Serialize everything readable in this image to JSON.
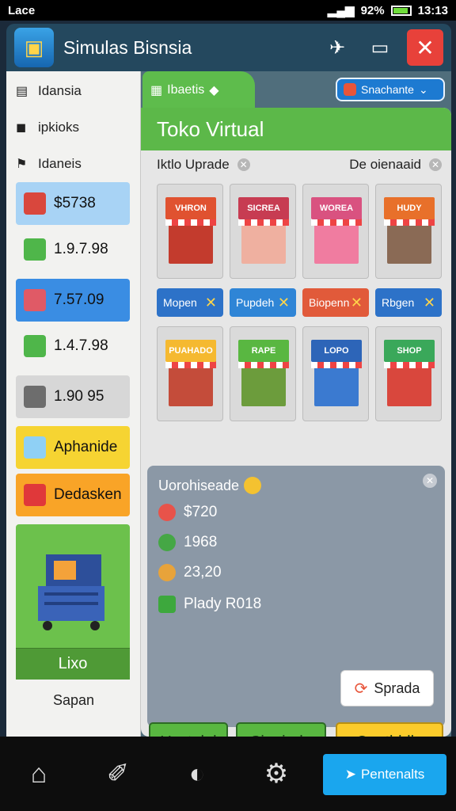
{
  "status_bar": {
    "carrier": "Lace",
    "battery": "92%",
    "time": "13:13"
  },
  "app": {
    "title": "Simulas Bisnsia",
    "logo_icon": "shop-icon"
  },
  "sidebar": {
    "links": [
      "Idansia",
      "ipkioks",
      "Idaneis"
    ],
    "stats": [
      {
        "value": "$5738",
        "color": "#a8d3f5",
        "icon_color": "#d9473d"
      },
      {
        "value": "1.9.7.98",
        "color": "#f2f2f0",
        "icon_color": "#4fb64a"
      },
      {
        "value": "7.57.09",
        "color": "#3a8de3",
        "icon_color": "#e05a66"
      },
      {
        "value": "1.4.7.98",
        "color": "#f2f2f0",
        "icon_color": "#4fb64a"
      },
      {
        "value": "1.90 95",
        "color": "#d7d7d7",
        "icon_color": "#6d6d6d"
      }
    ],
    "actions": [
      {
        "label": "Aphanide",
        "color": "#f6d432"
      },
      {
        "label": "Dedasken",
        "color": "#f9a427"
      }
    ],
    "card_label": "Lixo",
    "footer": "Sapan"
  },
  "tabs": {
    "active": "Ibaetis",
    "right_label": "Snachante"
  },
  "panel": {
    "title": "Toko Virtual",
    "filters": [
      "Iktlo Uprade",
      "De oienaaid"
    ],
    "shops": [
      {
        "sign": "VHRON",
        "sign_color": "#e05230",
        "body": "#c33b2d"
      },
      {
        "sign": "SICREA",
        "sign_color": "#c73c52",
        "body": "#efb0a0"
      },
      {
        "sign": "WOREA",
        "sign_color": "#d95280",
        "body": "#f07ca0"
      },
      {
        "sign": "HUDY",
        "sign_color": "#e8702a",
        "body": "#8a6a55"
      },
      {
        "sign": "PUAHADO",
        "sign_color": "#f5b930",
        "body": "#c44c3a"
      },
      {
        "sign": "RAPE",
        "sign_color": "#59b741",
        "body": "#6c9c3c"
      },
      {
        "sign": "LOPO",
        "sign_color": "#2d65b8",
        "body": "#3b7ad0"
      },
      {
        "sign": "SHOP",
        "sign_color": "#3aa85a",
        "body": "#d9473d"
      }
    ],
    "shop_buttons": [
      {
        "label": "Mopen",
        "color": "#2d72c8"
      },
      {
        "label": "Pupdeh",
        "color": "#2f85d6"
      },
      {
        "label": "Biopenn",
        "color": "#e15a3a"
      },
      {
        "label": "Rbgen",
        "color": "#2d72c8"
      }
    ],
    "details": {
      "title": "Uorohiseade",
      "lines": [
        {
          "icon_color": "#e8534a",
          "text": "$720"
        },
        {
          "icon_color": "#45a745",
          "text": "1968"
        },
        {
          "icon_color": "#e8a33a",
          "text": "23,20"
        },
        {
          "icon_color": "#3da83d",
          "text": "Plady R018"
        }
      ],
      "upgrade_label": "Sprada"
    },
    "bottom_buttons": [
      {
        "label": "Ucstalal",
        "color": "#59b741"
      },
      {
        "label": "Sipajade",
        "color": "#59b741"
      },
      {
        "label": "Ceatbldle",
        "color": "#fbcb2b"
      }
    ]
  },
  "navbar": {
    "icons": [
      "home-icon",
      "send-icon",
      "gallery-icon",
      "shield-icon",
      "settings-icon"
    ],
    "cta_label": "Pentenalts"
  }
}
